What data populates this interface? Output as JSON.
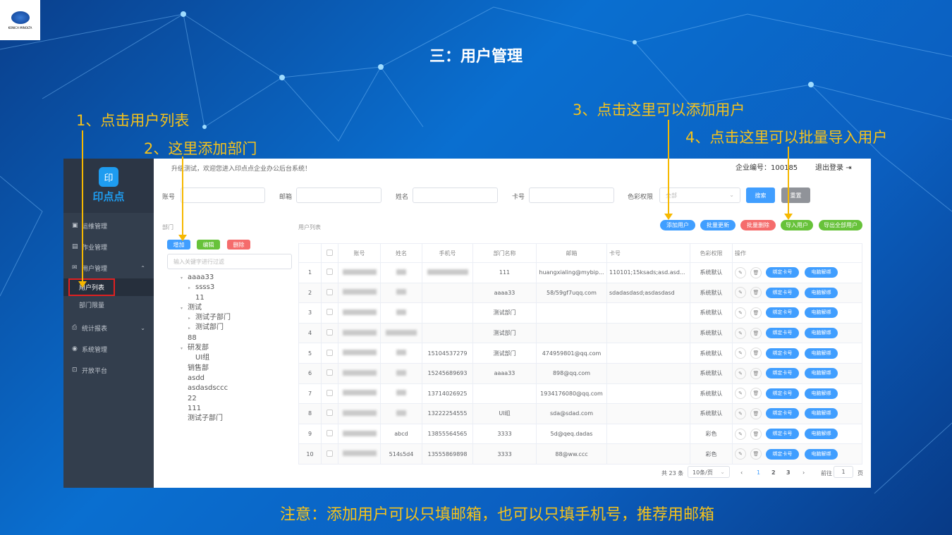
{
  "slide": {
    "title": "三：用户管理",
    "logo_text": "KONICA MINOLTA",
    "footer_note": "注意：添加用户可以只填邮箱，也可以只填手机号，推荐用邮箱",
    "annotations": [
      "1、点击用户列表",
      "2、这里添加部门",
      "3、点击这里可以添加用户",
      "4、点击这里可以批量导入用户"
    ],
    "accent": "#f6c21a"
  },
  "app": {
    "brand": "印点点",
    "brand_icon": "印",
    "welcome": "升级测试，欢迎您进入印点点企业办公后台系统！",
    "company_label": "企业编号：100185",
    "logout": "退出登录",
    "menu": [
      {
        "label": "运维管理",
        "icon": "calendar-icon"
      },
      {
        "label": "作业管理",
        "icon": "document-icon"
      },
      {
        "label": "用户管理",
        "icon": "mail-icon",
        "expanded": true
      },
      {
        "label": "用户列表",
        "sub": true,
        "active": true
      },
      {
        "label": "部门限量",
        "sub": true
      },
      {
        "label": "统计报表",
        "icon": "printer-icon"
      },
      {
        "label": "系统管理",
        "icon": "gear-icon"
      },
      {
        "label": "开放平台",
        "icon": "platform-icon"
      }
    ],
    "filters": {
      "account": "账号",
      "email": "邮箱",
      "name": "姓名",
      "card": "卡号",
      "color": "色彩权限",
      "color_value": "全部",
      "search": "搜索",
      "reset": "重置"
    },
    "dept": {
      "title": "部门",
      "add": "增加",
      "edit": "编辑",
      "delete": "删除",
      "filter_placeholder": "输入关键字进行过滤",
      "tree": [
        {
          "label": "aaaa33",
          "level": 0,
          "arrow": "down"
        },
        {
          "label": "ssss3",
          "level": 1,
          "arrow": "right"
        },
        {
          "label": "11",
          "level": 1
        },
        {
          "label": "测试",
          "level": 0,
          "arrow": "down"
        },
        {
          "label": "测试子部门",
          "level": 1,
          "arrow": "right"
        },
        {
          "label": "测试部门",
          "level": 1,
          "arrow": "right"
        },
        {
          "label": "88",
          "level": 0
        },
        {
          "label": "研发部",
          "level": 0,
          "arrow": "down"
        },
        {
          "label": "UI组",
          "level": 1
        },
        {
          "label": "销售部",
          "level": 0
        },
        {
          "label": "asdd",
          "level": 0
        },
        {
          "label": "asdasdsccc",
          "level": 0
        },
        {
          "label": "22",
          "level": 0
        },
        {
          "label": "111",
          "level": 0
        },
        {
          "label": "测试子部门",
          "level": 0
        }
      ]
    },
    "users": {
      "title": "用户列表",
      "actions": [
        "添加用户",
        "批量更新",
        "批量删除",
        "导入用户",
        "导出全部用户"
      ],
      "columns": [
        "",
        "",
        "账号",
        "姓名",
        "手机号",
        "部门名称",
        "邮箱",
        "卡号",
        "色彩权限",
        "操作"
      ],
      "bind_card": "绑定卡号",
      "unbind_pc": "电脑解绑",
      "rows": [
        {
          "no": "1",
          "phone": "",
          "dept": "111",
          "email": "huangxialing@mybip...",
          "card": "110101;15ksads;asd.asd...",
          "color": "系统默认"
        },
        {
          "no": "2",
          "phone": "",
          "dept": "aaaa33",
          "email": "58/59gf7uqq.com",
          "card": "sdadasdasd;asdasdasd",
          "color": "系统默认"
        },
        {
          "no": "3",
          "phone": "",
          "dept": "测试部门",
          "email": "",
          "card": "",
          "color": "系统默认"
        },
        {
          "no": "4",
          "phone": "",
          "dept": "测试部门",
          "email": "",
          "card": "",
          "color": "系统默认"
        },
        {
          "no": "5",
          "phone": "15104537279",
          "dept": "测试部门",
          "email": "474959801@qq.com",
          "card": "",
          "color": "系统默认"
        },
        {
          "no": "6",
          "phone": "15245689693",
          "dept": "aaaa33",
          "email": "898@qq.com",
          "card": "",
          "color": "系统默认"
        },
        {
          "no": "7",
          "phone": "13714026925",
          "dept": "",
          "email": "1934176080@qq.com",
          "card": "",
          "color": "系统默认"
        },
        {
          "no": "8",
          "phone": "13222254555",
          "dept": "UI组",
          "email": "sda@sdad.com",
          "card": "",
          "color": "系统默认"
        },
        {
          "no": "9",
          "name": "abcd",
          "phone": "13855564565",
          "dept": "3333",
          "email": "5d@qeq.dadas",
          "card": "",
          "color": "彩色"
        },
        {
          "no": "10",
          "name": "514s5d4",
          "phone": "13555869898",
          "dept": "3333",
          "email": "88@ww.ccc",
          "card": "",
          "color": "彩色"
        }
      ]
    },
    "pagination": {
      "total": "共 23 条",
      "page_size": "10条/页",
      "pages": [
        "1",
        "2",
        "3"
      ],
      "current": "1",
      "goto_label": "前往",
      "goto_value": "1",
      "page_suffix": "页"
    }
  }
}
